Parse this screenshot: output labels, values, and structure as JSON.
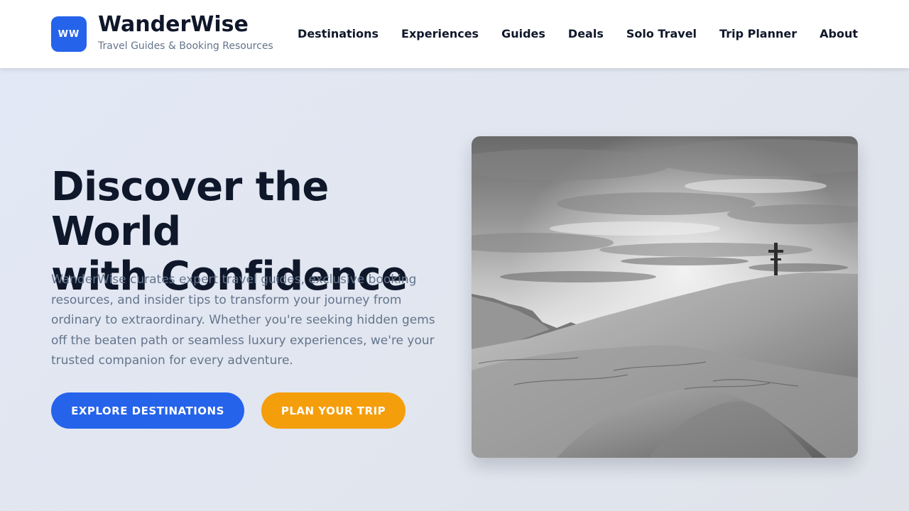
{
  "brand": {
    "logo_text": "WW",
    "name": "WanderWise",
    "tagline": "Travel Guides & Booking Resources"
  },
  "nav": {
    "items": [
      {
        "label": "Destinations"
      },
      {
        "label": "Experiences"
      },
      {
        "label": "Guides"
      },
      {
        "label": "Deals"
      },
      {
        "label": "Solo Travel"
      },
      {
        "label": "Trip Planner"
      },
      {
        "label": "About"
      }
    ]
  },
  "hero": {
    "title_line1": "Discover the World",
    "title_line2": "with Confidence",
    "description": "WanderWise curates expert travel guides, exclusive booking resources, and insider tips to transform your journey from ordinary to extraordinary. Whether you're seeking hidden gems off the beaten path or seamless luxury experiences, we're your trusted companion for every adventure.",
    "primary_button": "EXPLORE DESTINATIONS",
    "secondary_button": "PLAN YOUR TRIP",
    "image_alt": "Black and white snowy mountain summit with a cross under a cloudy sky"
  },
  "colors": {
    "brand_blue": "#2563eb",
    "accent_orange": "#f59e0b",
    "heading": "#0f172a",
    "muted_text": "#64748b"
  }
}
